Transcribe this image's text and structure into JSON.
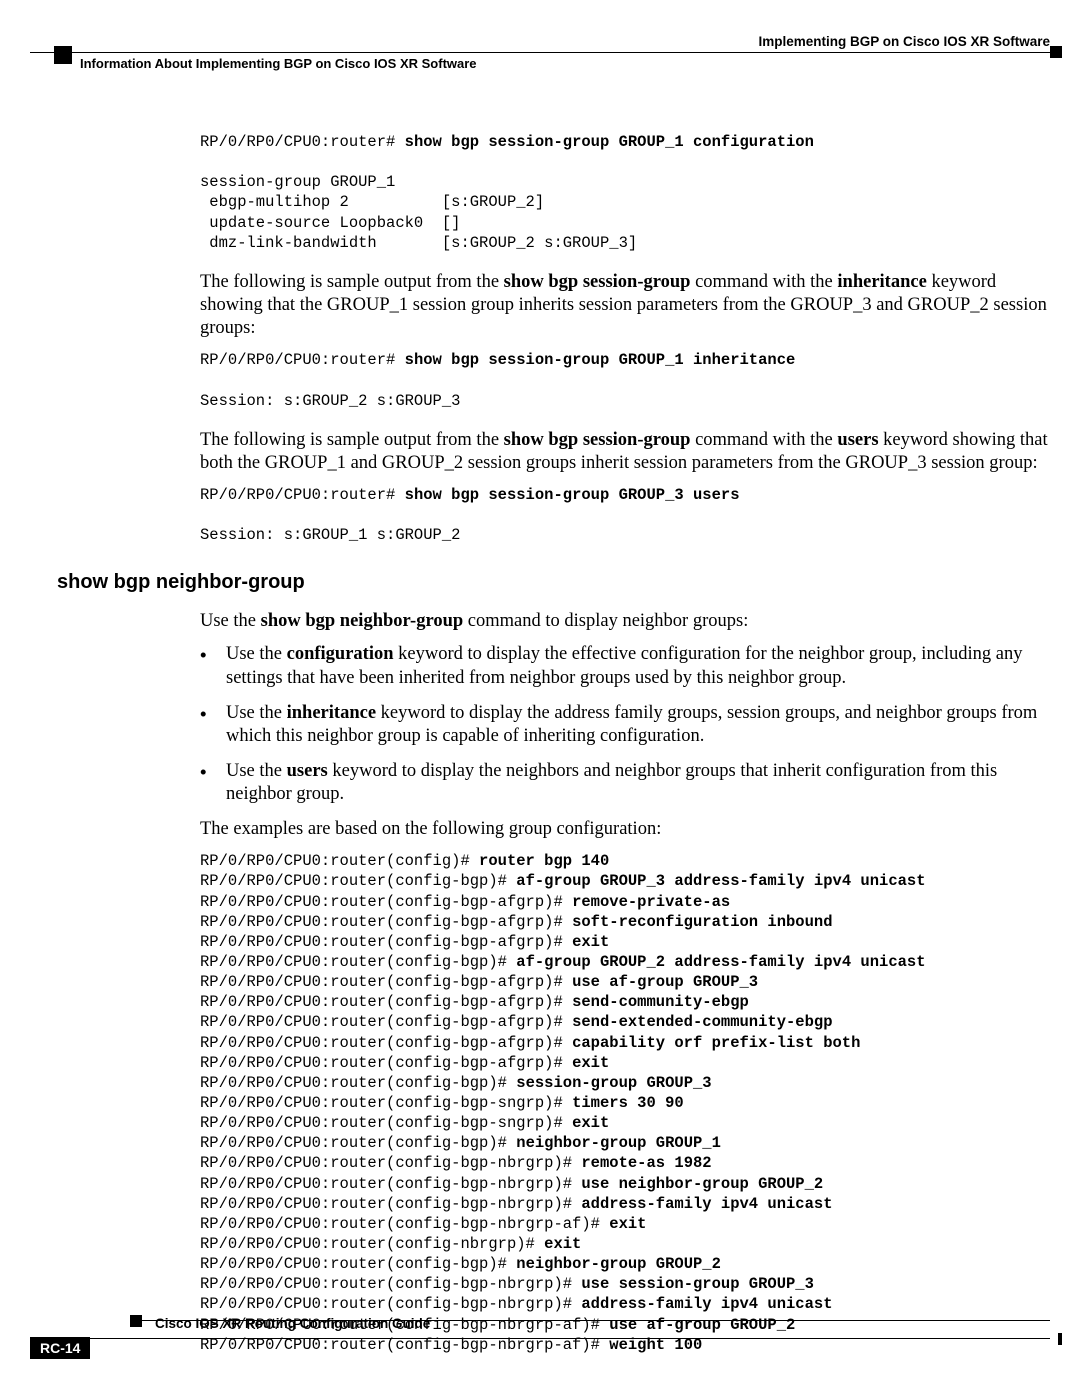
{
  "header": {
    "doc_title": "Implementing BGP on Cisco IOS XR Software",
    "section": "Information About Implementing BGP on Cisco IOS XR Software"
  },
  "code1": {
    "prompt": "RP/0/RP0/CPU0:router# ",
    "cmd": "show bgp session-group GROUP_1 configuration",
    "out": "session-group GROUP_1\n ebgp-multihop 2          [s:GROUP_2]\n update-source Loopback0  []\n dmz-link-bandwidth       [s:GROUP_2 s:GROUP_3]"
  },
  "para1a": "The following is sample output from the ",
  "para1b": "show bgp session-group",
  "para1c": " command with the ",
  "para1d": "inheritance",
  "para1e": " keyword showing that the GROUP_1 session group inherits session parameters from the GROUP_3 and GROUP_2 session groups:",
  "code2": {
    "prompt": "RP/0/RP0/CPU0:router# ",
    "cmd": "show bgp session-group GROUP_1 inheritance",
    "out": "Session: s:GROUP_2 s:GROUP_3"
  },
  "para2a": "The following is sample output from the ",
  "para2b": "show bgp session-group",
  "para2c": " command with the ",
  "para2d": "users",
  "para2e": " keyword showing that both the GROUP_1 and GROUP_2 session groups inherit session parameters from the GROUP_3 session group:",
  "code3": {
    "prompt": "RP/0/RP0/CPU0:router# ",
    "cmd": "show bgp session-group GROUP_3 users",
    "out": "Session: s:GROUP_1 s:GROUP_2"
  },
  "heading2": "show bgp neighbor-group",
  "para3a": "Use the ",
  "para3b": "show bgp neighbor-group",
  "para3c": " command to display neighbor groups:",
  "li1a": "Use the ",
  "li1b": "configuration",
  "li1c": " keyword to display the effective configuration for the neighbor group, including any settings that have been inherited from neighbor groups used by this neighbor group.",
  "li2a": "Use the ",
  "li2b": "inheritance",
  "li2c": " keyword to display the address family groups, session groups, and neighbor groups from which this neighbor group is capable of inheriting configuration.",
  "li3a": "Use the ",
  "li3b": "users",
  "li3c": " keyword to display the neighbors and neighbor groups that inherit configuration from this neighbor group.",
  "para4": "The examples are based on the following group configuration:",
  "cfg": [
    {
      "p": "RP/0/RP0/CPU0:router(config)# ",
      "c": "router bgp 140"
    },
    {
      "p": "RP/0/RP0/CPU0:router(config-bgp)# ",
      "c": "af-group GROUP_3 address-family ipv4 unicast"
    },
    {
      "p": "RP/0/RP0/CPU0:router(config-bgp-afgrp)# ",
      "c": "remove-private-as"
    },
    {
      "p": "RP/0/RP0/CPU0:router(config-bgp-afgrp)# ",
      "c": "soft-reconfiguration inbound"
    },
    {
      "p": "RP/0/RP0/CPU0:router(config-bgp-afgrp)# ",
      "c": "exit"
    },
    {
      "p": "RP/0/RP0/CPU0:router(config-bgp)# ",
      "c": "af-group GROUP_2 address-family ipv4 unicast"
    },
    {
      "p": "RP/0/RP0/CPU0:router(config-bgp-afgrp)# ",
      "c": "use af-group GROUP_3"
    },
    {
      "p": "RP/0/RP0/CPU0:router(config-bgp-afgrp)# ",
      "c": "send-community-ebgp"
    },
    {
      "p": "RP/0/RP0/CPU0:router(config-bgp-afgrp)# ",
      "c": "send-extended-community-ebgp"
    },
    {
      "p": "RP/0/RP0/CPU0:router(config-bgp-afgrp)# ",
      "c": "capability orf prefix-list both"
    },
    {
      "p": "RP/0/RP0/CPU0:router(config-bgp-afgrp)# ",
      "c": "exit"
    },
    {
      "p": "RP/0/RP0/CPU0:router(config-bgp)# ",
      "c": "session-group GROUP_3"
    },
    {
      "p": "RP/0/RP0/CPU0:router(config-bgp-sngrp)# ",
      "c": "timers 30 90"
    },
    {
      "p": "RP/0/RP0/CPU0:router(config-bgp-sngrp)# ",
      "c": "exit"
    },
    {
      "p": "RP/0/RP0/CPU0:router(config-bgp)# ",
      "c": "neighbor-group GROUP_1"
    },
    {
      "p": "RP/0/RP0/CPU0:router(config-bgp-nbrgrp)# ",
      "c": "remote-as 1982"
    },
    {
      "p": "RP/0/RP0/CPU0:router(config-bgp-nbrgrp)# ",
      "c": "use neighbor-group GROUP_2"
    },
    {
      "p": "RP/0/RP0/CPU0:router(config-bgp-nbrgrp)# ",
      "c": "address-family ipv4 unicast"
    },
    {
      "p": "RP/0/RP0/CPU0:router(config-bgp-nbrgrp-af)# ",
      "c": "exit"
    },
    {
      "p": "RP/0/RP0/CPU0:router(config-nbrgrp)# ",
      "c": "exit"
    },
    {
      "p": "RP/0/RP0/CPU0:router(config-bgp)# ",
      "c": "neighbor-group GROUP_2"
    },
    {
      "p": "RP/0/RP0/CPU0:router(config-bgp-nbrgrp)# ",
      "c": "use session-group GROUP_3"
    },
    {
      "p": "RP/0/RP0/CPU0:router(config-bgp-nbrgrp)# ",
      "c": "address-family ipv4 unicast"
    },
    {
      "p": "RP/0/RP0/CPU0:router(config-bgp-nbrgrp-af)# ",
      "c": "use af-group GROUP_2"
    },
    {
      "p": "RP/0/RP0/CPU0:router(config-bgp-nbrgrp-af)# ",
      "c": "weight 100"
    }
  ],
  "footer": {
    "guide": "Cisco IOS XR Routing Configuration Guide",
    "pagenum": "RC-14"
  },
  "bullet": "•"
}
